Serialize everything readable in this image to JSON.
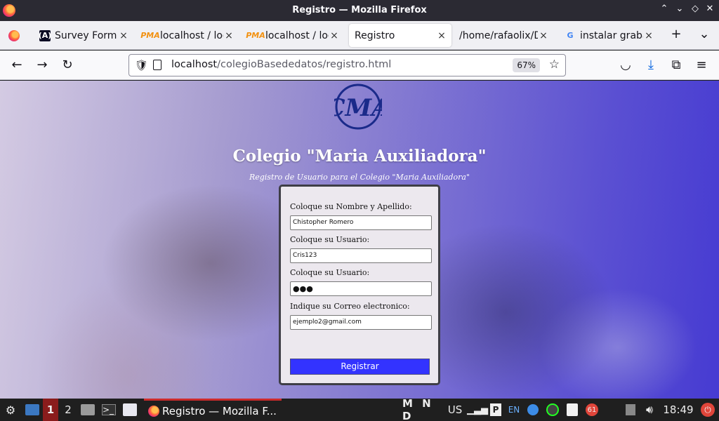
{
  "window": {
    "title": "Registro — Mozilla Firefox",
    "controls": {
      "minimize": "⌃",
      "restore": "⌄",
      "maximize": "◇",
      "close": "✕"
    }
  },
  "tabs": [
    {
      "label": "Survey Form:",
      "icon": "freecodecamp-icon",
      "active": false
    },
    {
      "label": "localhost / loc",
      "icon": "phpmyadmin-icon",
      "active": false
    },
    {
      "label": "localhost / loc",
      "icon": "phpmyadmin-icon",
      "active": false
    },
    {
      "label": "Registro",
      "icon": "none",
      "active": true
    },
    {
      "label": "/home/rafaolix/D",
      "icon": "none",
      "active": false
    },
    {
      "label": "instalar graba",
      "icon": "google-icon",
      "active": false
    }
  ],
  "tab_icons": {
    "fcc": "(A)",
    "pma": "PMA",
    "google": "G",
    "close": "×",
    "new_tab": "+",
    "list_all": "⌄"
  },
  "nav": {
    "back": "←",
    "forward": "→",
    "reload": "↻",
    "url_host": "localhost",
    "url_path": "/colegioBasededatos/registro.html",
    "zoom": "67%",
    "bookmark_star": "☆",
    "shield": "🛡"
  },
  "toolbar_icons": {
    "pocket": "◡",
    "downloads": "⤓",
    "extensions": "⧉",
    "menu": "≡"
  },
  "page": {
    "title": "Colegio \"Maria Auxiliadora\"",
    "subtitle": "Registro de Usuario para el Colegio \"Maria Auxiliadora\"",
    "logo_text": "CMA",
    "form": {
      "name_label": "Coloque su Nombre y Apellido:",
      "name_value": "Chistopher Romero",
      "user_label": "Coloque su Usuario:",
      "user_value": "Cris123",
      "password_label": "Coloque su Usuario:",
      "password_value": "●●●",
      "email_label": "Indique su Correo electronico:",
      "email_value": "ejemplo2@gmail.com",
      "submit_label": "Registrar"
    }
  },
  "taskbar": {
    "workspace_1": "1",
    "workspace_2": "2",
    "active_task": "Registro — Mozilla F...",
    "indicators": "M N D",
    "keyboard_layout": "US",
    "lang": "EN",
    "notification_count": "61",
    "clock": "18:49"
  },
  "colors": {
    "submit_button": "#3333ff",
    "workspace_active": "#8a1c1c",
    "title_text": "#ffffff"
  }
}
